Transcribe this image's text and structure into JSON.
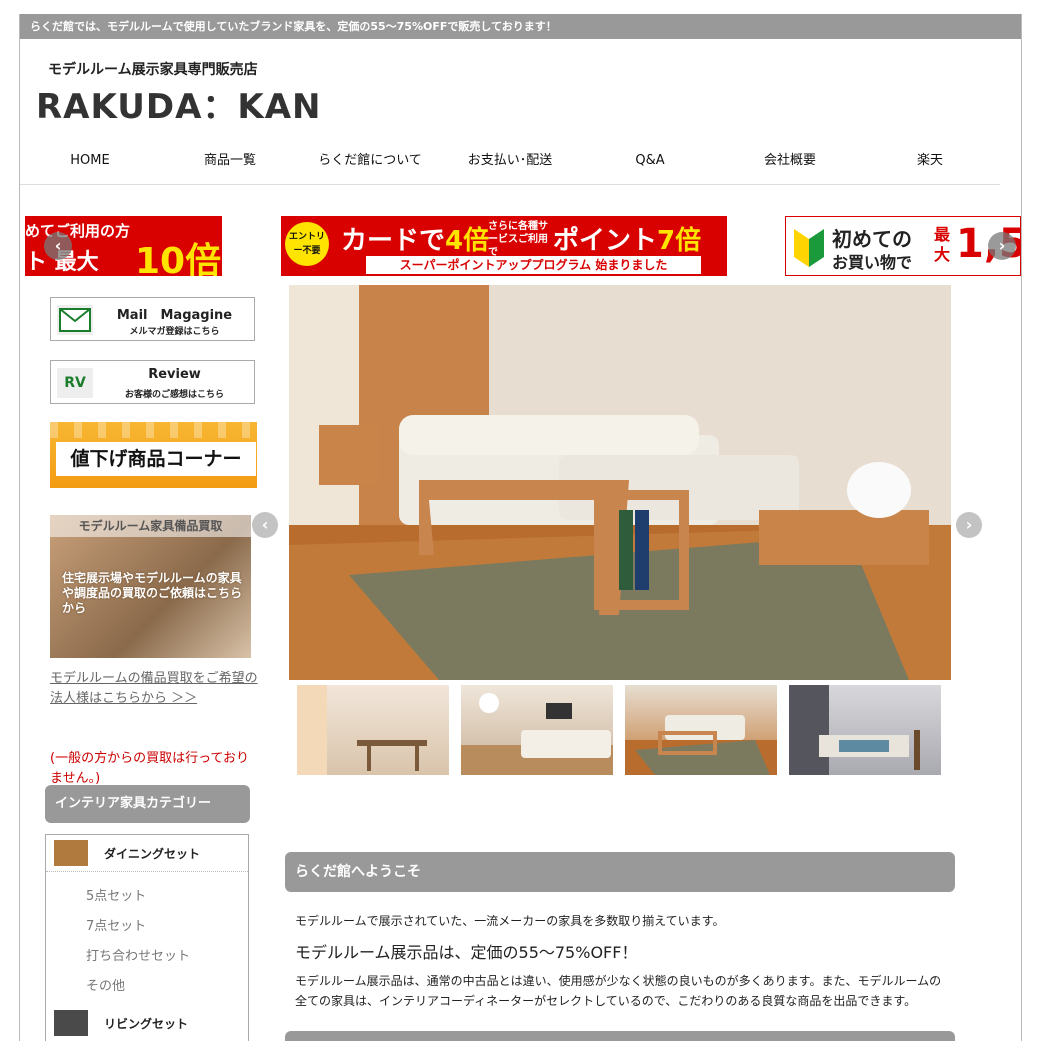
{
  "topbar": {
    "text": "らくだ館では、モデルルームで使用していたブランド家具を、定価の55〜75%OFFで販売しております！"
  },
  "header": {
    "tagline": "モデルルーム展示家具専門販売店",
    "logo": "RAKUDA：KAN"
  },
  "nav": [
    {
      "label": "HOME"
    },
    {
      "label": "商品一覧"
    },
    {
      "label": "らくだ館について"
    },
    {
      "label": "お支払い･配送"
    },
    {
      "label": "Q&A"
    },
    {
      "label": "会社概要"
    },
    {
      "label": "楽天"
    }
  ],
  "banners": {
    "left": {
      "line1": "めてご利用の方",
      "big1": "ト 最大",
      "big2": "10倍"
    },
    "center": {
      "badge": "エントリー不要",
      "card": "カードで",
      "four": "4倍",
      "sub": "さらに各種サービスご利用で",
      "point": "ポイント",
      "seven": "7倍",
      "bottom": "スーパーポイントアッププログラム 始まりました"
    },
    "right": {
      "l1": "初めての",
      "l2": "お買い物で",
      "max": "最大",
      "num": "1,5"
    }
  },
  "sidebar": {
    "mail": {
      "icon": "mail-icon",
      "title": "Mail　Magagine",
      "sub": "メルマガ登録はこちら"
    },
    "review": {
      "icon": "RV",
      "title": "Review",
      "sub": "お客様のご感想はこちら"
    },
    "pricecut": "値下げ商品コーナー",
    "buyback": {
      "title": "モデルルーム家具備品買取",
      "body": "住宅展示場やモデルルームの家具や調度品の買取のご依頼はこちらから"
    },
    "link_text": "モデルルームの備品買取をご希望の\n法人様はこちらから ＞＞",
    "note": "(一般の方からの買取は行っておりません。)",
    "category_title": "インテリア家具カテゴリー",
    "categories": [
      {
        "label": "ダイニングセット",
        "subs": [
          "5点セット",
          "7点セット",
          "打ち合わせセット",
          "その他"
        ]
      },
      {
        "label": "リビングセット",
        "subs": []
      }
    ]
  },
  "main": {
    "welcome_title": "らくだ館へようこそ",
    "welcome_line1": "モデルルームで展示されていた、一流メーカーの家具を多数取り揃えています。",
    "welcome_line2": "モデルルーム展示品は、定価の55〜75%OFF！",
    "welcome_line3": "モデルルーム展示品は、通常の中古品とは違い、使用感が少なく状態の良いものが多くあります。また、モデルルームの全ての家具は、インテリアコーディネーターがセレクトしているので、こだわりのある良質な商品を出品できます。"
  },
  "colors": {
    "bar": "#999999",
    "red": "#d90000",
    "orange": "#f39c12",
    "note": "#cc0000"
  }
}
